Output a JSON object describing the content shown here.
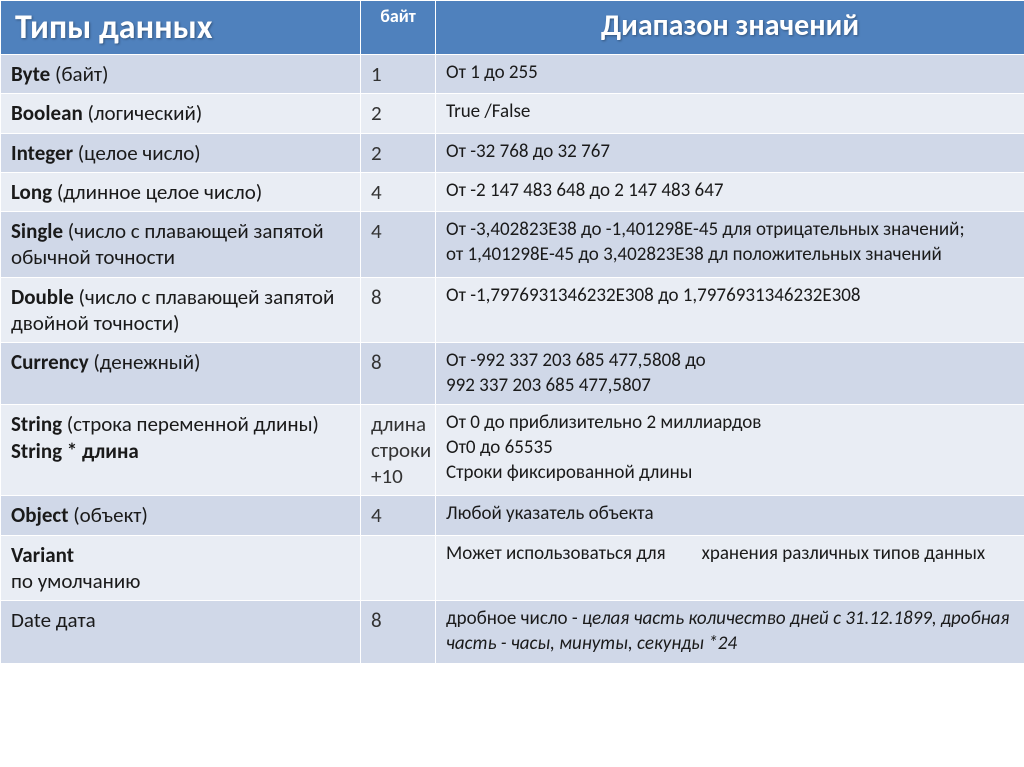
{
  "headers": {
    "types": "Типы данных",
    "bytes": "байт",
    "range": "Диапазон значений"
  },
  "rows": [
    {
      "type_bold": "Byte",
      "type_rest": " (байт)",
      "bytes": "1",
      "range": "От 1 до 255"
    },
    {
      "type_bold": "Boolean",
      "type_rest": " (логический)",
      "bytes": "2",
      "range": "True /False"
    },
    {
      "type_bold": "Integer",
      "type_rest": " (целое число)",
      "bytes": "2",
      "range": "От -32 768 до 32 767"
    },
    {
      "type_bold": "Long",
      "type_rest": " (длинное целое число)",
      "bytes": "4",
      "range": "От -2 147 483 648 до 2 147 483 647"
    },
    {
      "type_bold": "Single",
      "type_rest": " (число с плавающей запятой обычной точности",
      "bytes": "4",
      "range": "От -3,402823Е38 до -1,401298Е-45 для отрицательных значений;\nот 1,401298Е-45 до 3,402823Е38 дл положительных значений"
    },
    {
      "type_bold": "Double",
      "type_rest": " (число с плавающей запятой двойной точности)",
      "bytes": "8",
      "range": "От -1,7976931346232Е308 до 1,7976931346232Е308"
    },
    {
      "type_bold": "Currency",
      "type_rest": " (денежный)",
      "bytes": "8",
      "range": "От -992 337 203 685 477,5808 до\n992 337 203 685 477,5807"
    },
    {
      "type_line1_bold": "String",
      "type_line1_rest": " (строка переменной длины)",
      "type_line2_bold": "String * длина",
      "bytes": "длина строки +10",
      "range": "От 0 до приблизительно 2 миллиардов\nОт0 до 65535\nСтроки фиксированной длины"
    },
    {
      "type_bold": "Object",
      "type_rest": " (объект)",
      "bytes": "4",
      "range": "Любой указатель объекта"
    },
    {
      "type_bold": "Variant",
      "type_rest": "",
      "type_line2_plain": "по умолчанию",
      "bytes": "",
      "range_pre": "Может использоваться для",
      "range_post": "хранения различных типов данных"
    },
    {
      "type_plain": "Date  дата",
      "bytes": "8",
      "range_pre2": "дробное число - ",
      "range_ital": "целая часть количество дней с 31.12.1899, дробная часть - часы, минуты, секунды *24"
    }
  ]
}
